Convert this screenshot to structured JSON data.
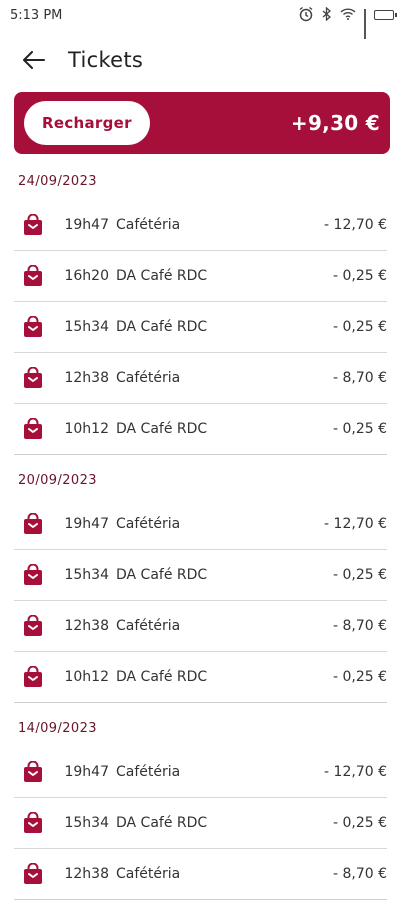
{
  "status_bar": {
    "time": "5:13 PM",
    "battery": "69"
  },
  "header": {
    "title": "Tickets"
  },
  "balance": {
    "recharge_label": "Recharger",
    "amount": "+9,30 €"
  },
  "accent_color": "#a60f3a",
  "groups": [
    {
      "date": "24/09/2023",
      "items": [
        {
          "time": "19h47",
          "place": "Cafétéria",
          "amount": "- 12,70 €"
        },
        {
          "time": "16h20",
          "place": "DA Café RDC",
          "amount": "- 0,25 €"
        },
        {
          "time": "15h34",
          "place": "DA Café RDC",
          "amount": "- 0,25 €"
        },
        {
          "time": "12h38",
          "place": "Cafétéria",
          "amount": "- 8,70 €"
        },
        {
          "time": "10h12",
          "place": "DA Café RDC",
          "amount": "- 0,25 €"
        }
      ]
    },
    {
      "date": "20/09/2023",
      "items": [
        {
          "time": "19h47",
          "place": "Cafétéria",
          "amount": "- 12,70 €"
        },
        {
          "time": "15h34",
          "place": "DA Café RDC",
          "amount": "- 0,25 €"
        },
        {
          "time": "12h38",
          "place": "Cafétéria",
          "amount": "- 8,70 €"
        },
        {
          "time": "10h12",
          "place": "DA Café RDC",
          "amount": "- 0,25 €"
        }
      ]
    },
    {
      "date": "14/09/2023",
      "items": [
        {
          "time": "19h47",
          "place": "Cafétéria",
          "amount": "- 12,70 €"
        },
        {
          "time": "15h34",
          "place": "DA Café RDC",
          "amount": "- 0,25 €"
        },
        {
          "time": "12h38",
          "place": "Cafétéria",
          "amount": "- 8,70 €"
        }
      ]
    }
  ]
}
